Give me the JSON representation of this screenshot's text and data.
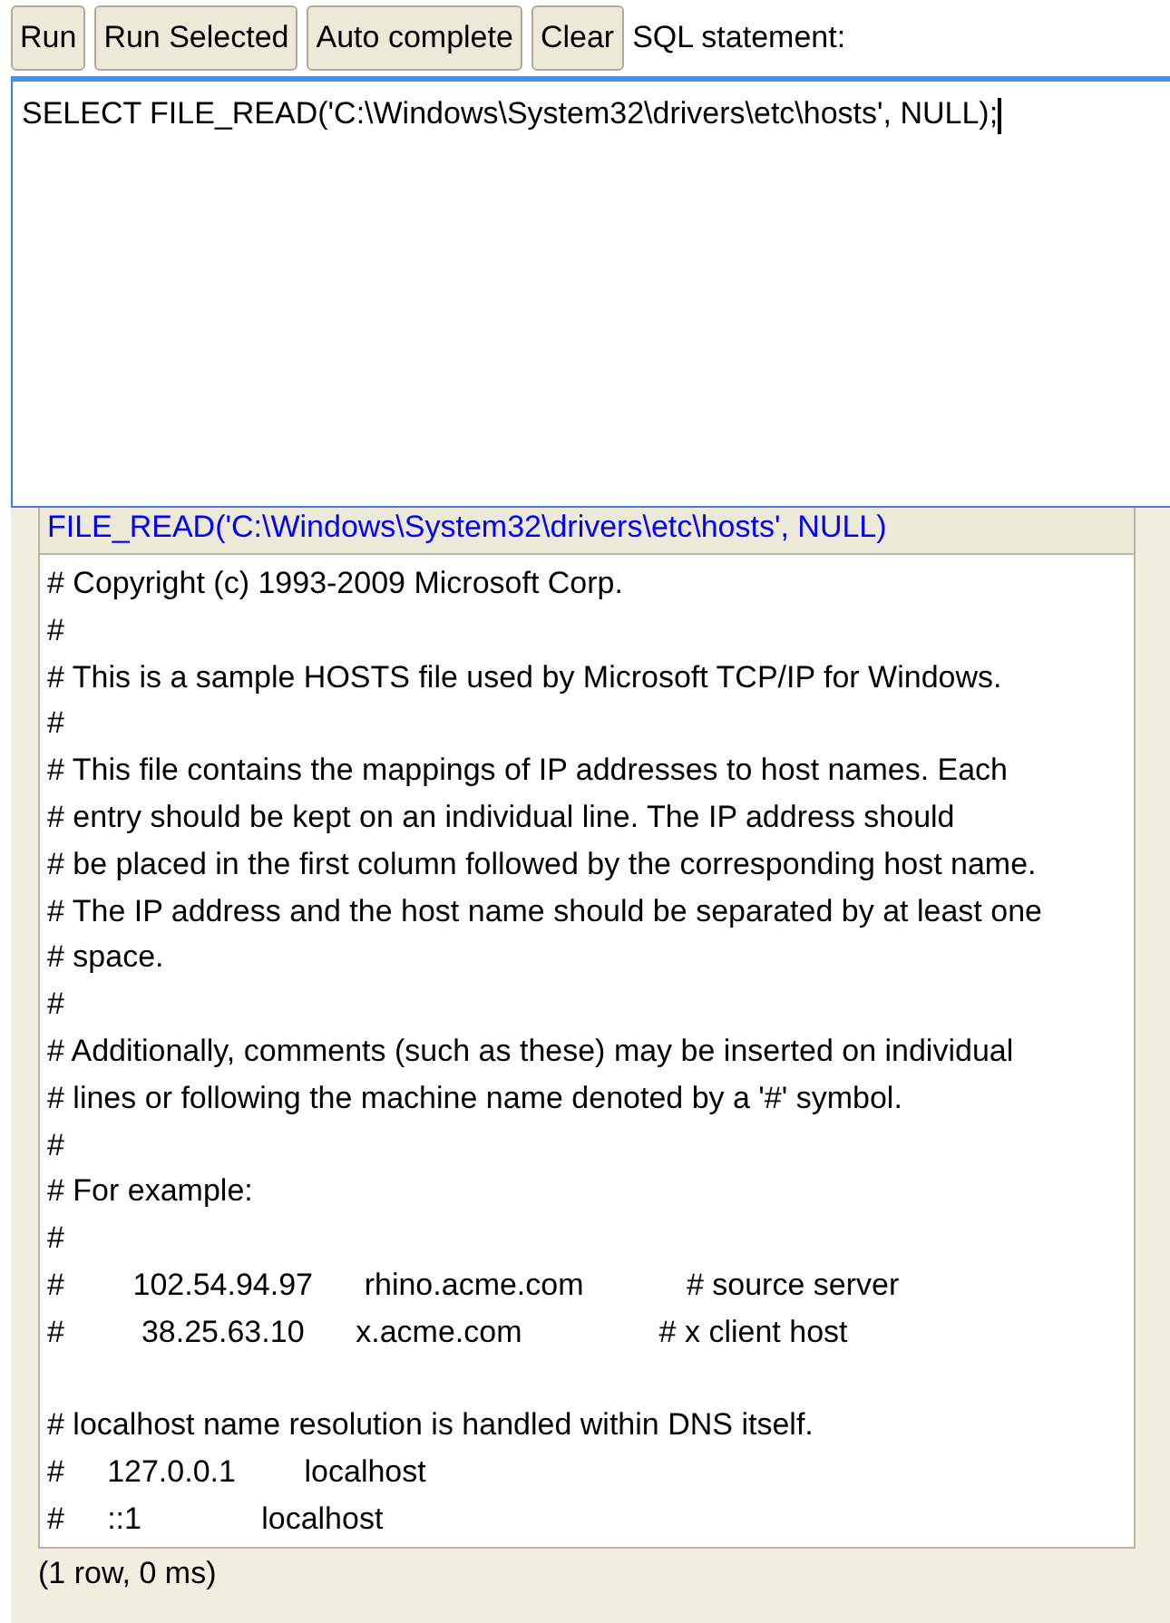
{
  "toolbar": {
    "buttons": [
      "Run",
      "Run Selected",
      "Auto complete",
      "Clear"
    ],
    "label": "SQL statement:"
  },
  "editor": {
    "value": "SELECT FILE_READ('C:\\Windows\\System32\\drivers\\etc\\hosts', NULL);"
  },
  "result": {
    "columns": [
      "FILE_READ('C:\\Windows\\System32\\drivers\\etc\\hosts', NULL)"
    ],
    "rows": [
      [
        "# Copyright (c) 1993-2009 Microsoft Corp.\n#\n# This is a sample HOSTS file used by Microsoft TCP/IP for Windows.\n#\n# This file contains the mappings of IP addresses to host names. Each\n# entry should be kept on an individual line. The IP address should\n# be placed in the first column followed by the corresponding host name.\n# The IP address and the host name should be separated by at least one\n# space.\n#\n# Additionally, comments (such as these) may be inserted on individual\n# lines or following the machine name denoted by a '#' symbol.\n#\n# For example:\n#\n#        102.54.94.97      rhino.acme.com            # source server\n#         38.25.63.10      x.acme.com                # x client host\n\n# localhost name resolution is handled within DNS itself.\n#     127.0.0.1        localhost\n#     ::1              localhost"
      ]
    ],
    "status": "(1 row, 0 ms)"
  }
}
